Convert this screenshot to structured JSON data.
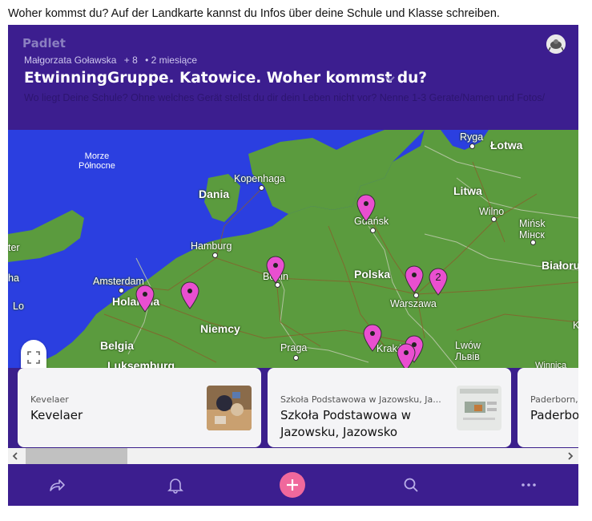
{
  "caption": "Woher kommst du?  Auf der Landkarte kannst du Infos über deine Schule und Klasse schreiben.",
  "header": {
    "logo": "Padlet",
    "author": "Małgorzata Goławska",
    "contributors": "+ 8",
    "time": "• 2 miesiące",
    "title": "EtwinningGruppe. Katowice. Woher kommst du?",
    "description": "Wo liegt Deine Schule? Ohne welches Gerät stellst du dir dein Leben nicht vor? Nenne 1-3 Gerate/Namen und Fotos/"
  },
  "map": {
    "labels": {
      "morze": "Morze\nPółnocne",
      "ryga": "Ryga",
      "lotwa": "Łotwa",
      "dania": "Dania",
      "kopenhaga": "Kopenhaga",
      "litwa": "Litwa",
      "wilno": "Wilno",
      "minsk": "Mińsk\nМінск",
      "gdansk": "Gdańsk",
      "hamburg": "Hamburg",
      "amsterdam": "Amsterdam",
      "holandia": "Holandia",
      "berlin": "Berlin",
      "polska": "Polska",
      "warszawa": "Warszawa",
      "bialorus": "Białoruś",
      "niemcy": "Niemcy",
      "belgia": "Belgia",
      "luksemburg": "Luksemburg",
      "praga": "Praga",
      "krakow": "Kraków",
      "lwow": "Lwów\nЛьвів",
      "winnica": "Winnica",
      "edge_lo": "Lo",
      "edge_ter": "ter",
      "edge_ha": "ha",
      "edge_k": "K"
    },
    "cluster_count": "2"
  },
  "cards": [
    {
      "subtitle": "Kevelaer",
      "title": "Kevelaer"
    },
    {
      "subtitle": "Szkoła Podstawowa w Jazowsku, Ja...",
      "title": "Szkoła Podstawowa w Jazowsku, Jazowsko"
    },
    {
      "subtitle": "Paderborn, ...",
      "title": "Paderbo"
    }
  ],
  "colors": {
    "brand": "#3c1e8f",
    "accent": "#f0689c",
    "pin": "#e94fd0",
    "land": "#5b9b3e",
    "water": "#2b3fe0"
  }
}
